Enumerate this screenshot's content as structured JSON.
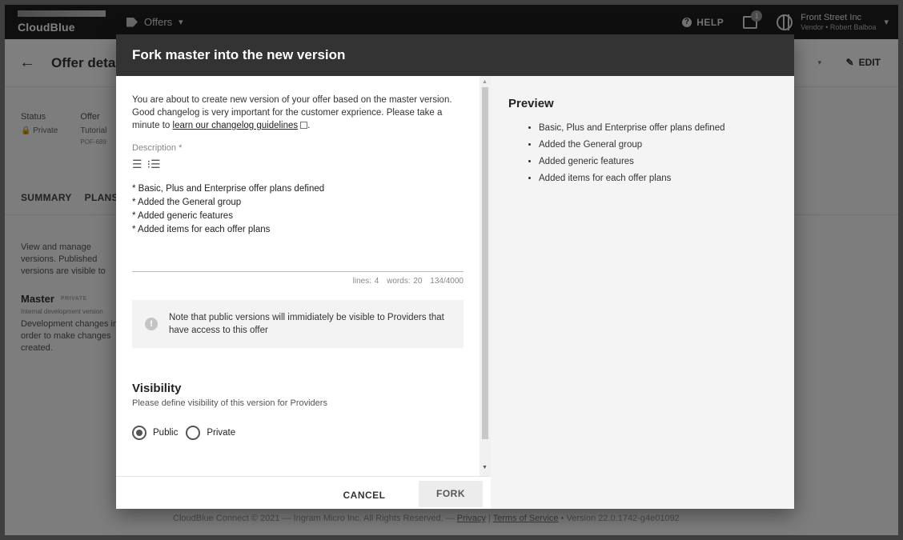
{
  "app": {
    "brand": "CloudBlue",
    "module": "Offers",
    "help_label": "HELP",
    "notifications_count": "1",
    "account_company": "Front Street Inc",
    "account_user": "Vendor • Robert Balboa",
    "page_title": "Offer details",
    "edit_label": "EDIT",
    "status_label": "Status",
    "status_value": "Private",
    "offer_label": "Offer",
    "offer_value": "Tutorial",
    "offer_id": "POF-689",
    "tabs": [
      "SUMMARY",
      "PLANS"
    ],
    "description": "View and manage versions. Published versions are visible to",
    "master_title": "Master",
    "master_badge": "PRIVATE",
    "master_sub": "Internal development version",
    "master_desc": "Development changes in order to make changes created.",
    "footer_left": "CloudBlue Connect © 2021 — Ingram Micro Inc. All Rights Reserved. —",
    "footer_privacy": "Privacy",
    "footer_terms": "Terms of Service",
    "footer_version": "• Version 22.0.1742-g4e01092"
  },
  "modal": {
    "title": "Fork master into the new version",
    "intro_part1": "You are about to create new version of your offer based on the master version. Good changelog is very important for the customer exprience. Please take a minute to",
    "intro_link": "learn our changelog guidelines",
    "intro_end": ".",
    "description_label": "Description *",
    "description_lines": [
      "* Basic, Plus and Enterprise offer plans defined",
      "* Added the General group",
      "* Added generic features",
      "* Added items for each offer plans"
    ],
    "counter_lines": "lines: 4",
    "counter_words": "words: 20",
    "counter_chars": "134/4000",
    "note": "Note that public versions will immidiately be visible to Providers that have access to this offer",
    "visibility_title": "Visibility",
    "visibility_sub": "Please define visibility of this version for Providers",
    "radio_public": "Public",
    "radio_private": "Private",
    "selected_visibility": "Public",
    "cancel_label": "CANCEL",
    "fork_label": "FORK",
    "preview_title": "Preview",
    "preview_items": [
      "Basic, Plus and Enterprise offer plans defined",
      "Added the General group",
      "Added generic features",
      "Added items for each offer plans"
    ]
  }
}
